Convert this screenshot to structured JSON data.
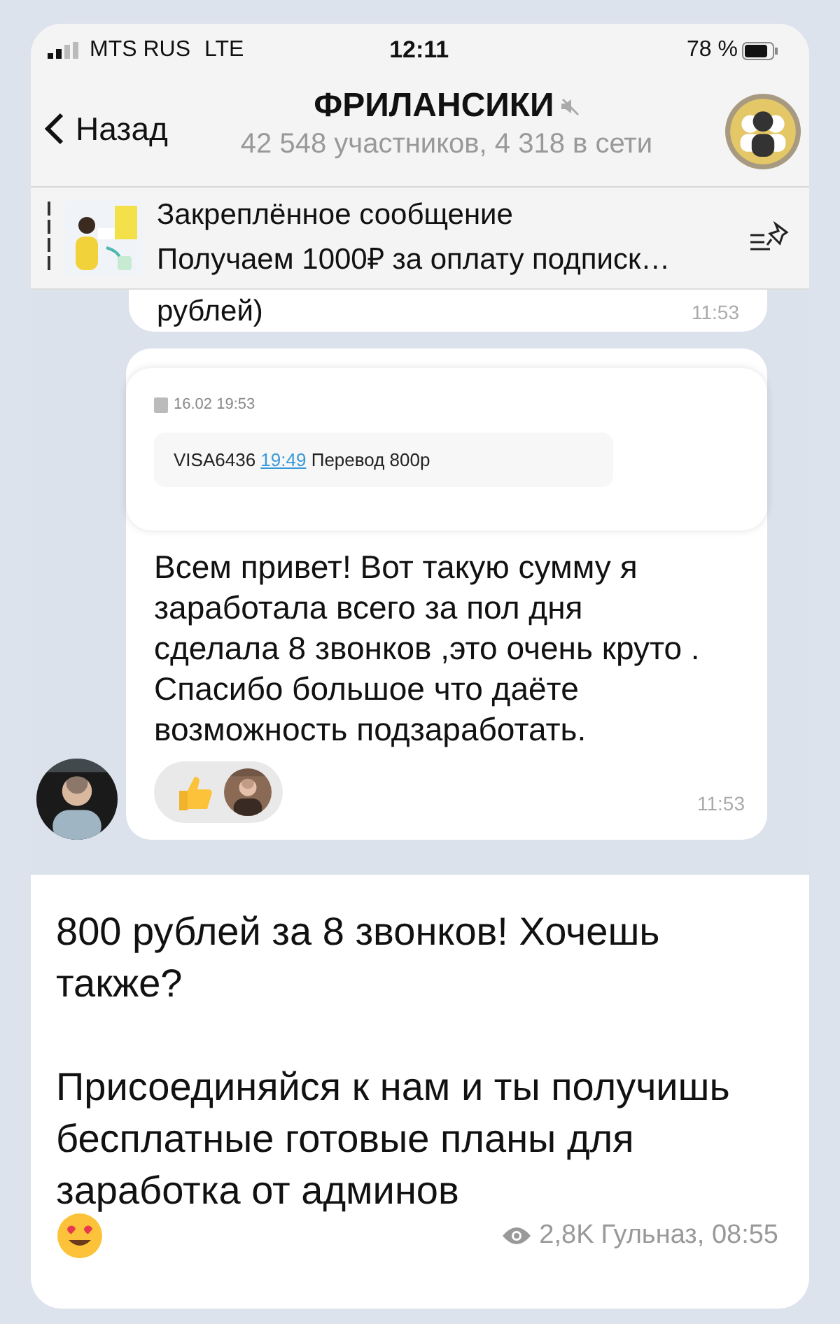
{
  "status_bar": {
    "carrier": "MTS RUS",
    "network": "LTE",
    "time": "12:11",
    "battery": "78 %"
  },
  "header": {
    "back": "Назад",
    "title": "ФРИЛАНСИКИ",
    "subtitle": "42 548 участников, 4 318 в сети",
    "muted": true
  },
  "pinned": {
    "title": "Закреплённое сообщение",
    "text": "Получаем 1000₽ за оплату подписк…"
  },
  "messages": [
    {
      "kind": "cut",
      "text": "рублей)",
      "time": "11:53"
    },
    {
      "receipt": {
        "date": "16.02 19:53",
        "card": "VISA6436",
        "link": "19:49",
        "text": "Перевод 800р"
      },
      "text": "Всем привет! Вот такую сумму я заработала всего за пол дня сделала 8 звонков ,это очень круто . Спасибо большое что даёте возможность подзаработать.",
      "time": "11:53"
    }
  ],
  "post": {
    "paragraphs": [
      "800 рублей за 8 звонков! Хочешь также?",
      "Присоединяйся к нам и ты получишь бесплатные готовые планы для заработка от админов"
    ],
    "views": "2,8K",
    "signature": "Гульназ, 08:55"
  }
}
